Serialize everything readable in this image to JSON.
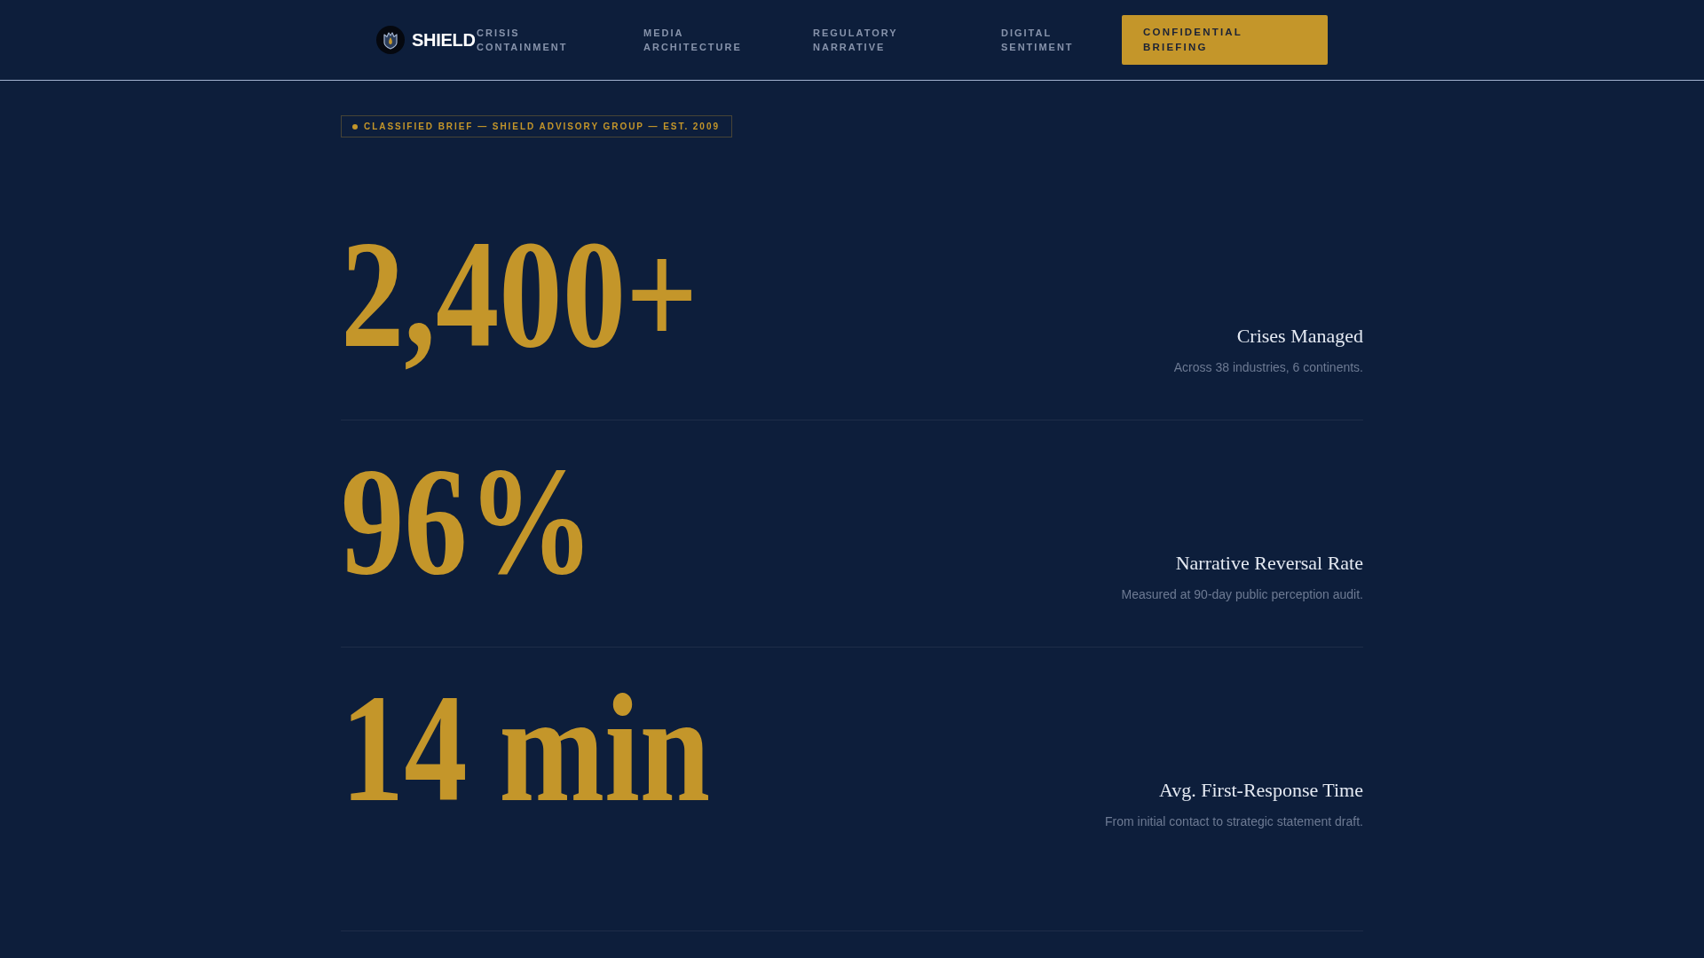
{
  "nav": {
    "brand": "SHIELD",
    "links": [
      {
        "label": "CRISIS CONTAINMENT"
      },
      {
        "label": "MEDIA ARCHITECTURE"
      },
      {
        "label": "REGULATORY NARRATIVE"
      },
      {
        "label": "DIGITAL SENTIMENT"
      }
    ],
    "cta": "CONFIDENTIAL BRIEFING"
  },
  "badge": "CLASSIFIED BRIEF — SHIELD ADVISORY GROUP — EST. 2009",
  "stats": [
    {
      "value": "2,400+",
      "title": "Crises Managed",
      "description": "Across 38 industries, 6 continents."
    },
    {
      "value": "96%",
      "title": "Narrative Reversal Rate",
      "description": "Measured at 90-day public perception audit."
    },
    {
      "value": "14 min",
      "title": "Avg. First-Response Time",
      "description": "From initial contact to strategic statement draft."
    }
  ]
}
